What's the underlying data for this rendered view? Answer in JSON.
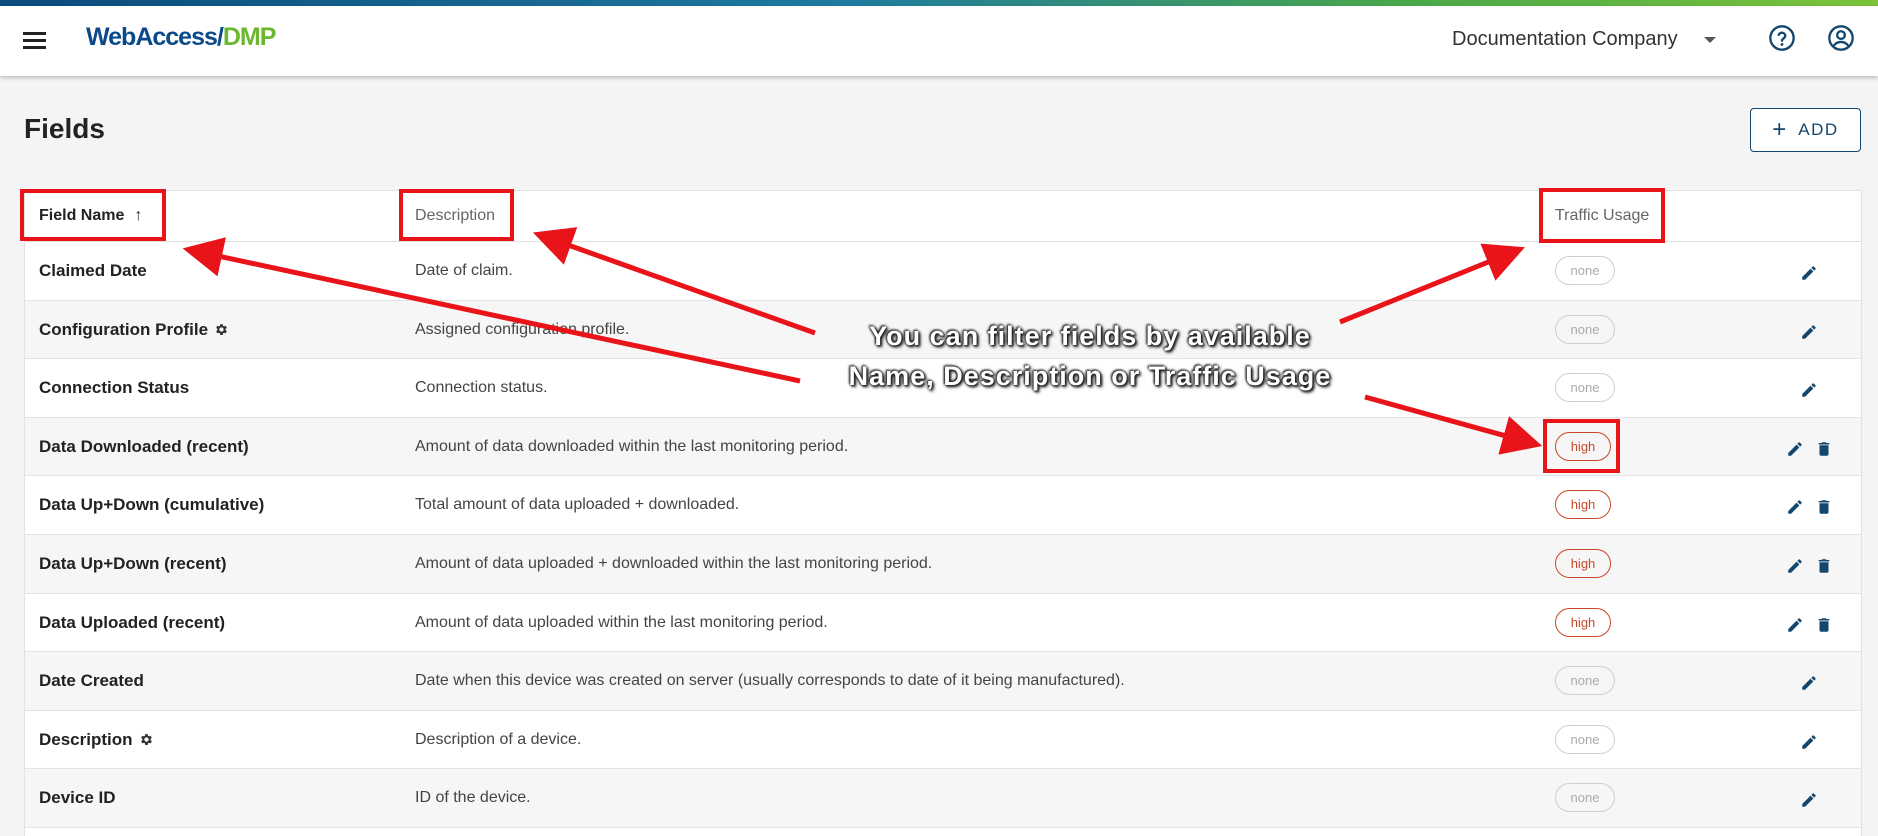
{
  "header": {
    "logo_part1": "WebAccess/",
    "logo_part2": "DMP",
    "company": "Documentation Company"
  },
  "page": {
    "title": "Fields",
    "add_label": "ADD"
  },
  "table": {
    "columns": {
      "name": "Field Name",
      "description": "Description",
      "traffic": "Traffic Usage"
    },
    "rows": [
      {
        "name": "Claimed Date",
        "description": "Date of claim.",
        "traffic": "none"
      },
      {
        "name": "Configuration Profile",
        "description": "Assigned configuration profile.",
        "traffic": "none"
      },
      {
        "name": "Connection Status",
        "description": "Connection status.",
        "traffic": "none"
      },
      {
        "name": "Data Downloaded (recent)",
        "description": "Amount of data downloaded within the last monitoring period.",
        "traffic": "high"
      },
      {
        "name": "Data Up+Down (cumulative)",
        "description": "Total amount of data uploaded + downloaded.",
        "traffic": "high"
      },
      {
        "name": "Data Up+Down (recent)",
        "description": "Amount of data uploaded + downloaded within the last monitoring period.",
        "traffic": "high"
      },
      {
        "name": "Data Uploaded (recent)",
        "description": "Amount of data uploaded within the last monitoring period.",
        "traffic": "high"
      },
      {
        "name": "Date Created",
        "description": "Date when this device was created on server (usually corresponds to date of it being manufactured).",
        "traffic": "none"
      },
      {
        "name": "Description",
        "description": "Description of a device.",
        "traffic": "none"
      },
      {
        "name": "Device ID",
        "description": "ID of the device.",
        "traffic": "none"
      }
    ]
  },
  "annotation": {
    "line1": "You can filter fields by available",
    "line2": "Name, Description or Traffic Usage",
    "color": "#e8141a"
  }
}
